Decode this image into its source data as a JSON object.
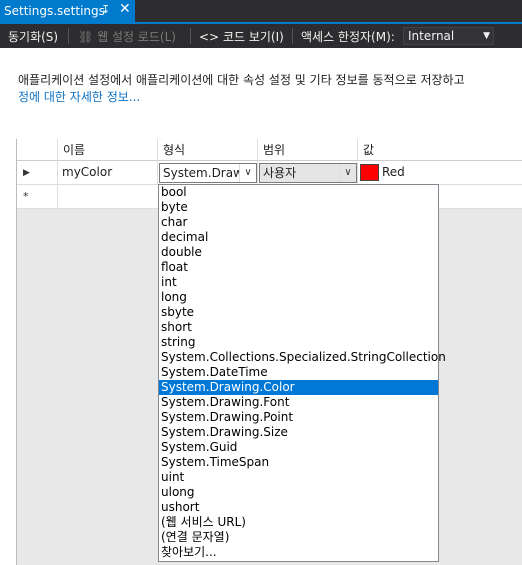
{
  "tab": {
    "title": "Settings.settings",
    "pin_glyph": "↧",
    "close_glyph": "✕"
  },
  "toolbar": {
    "sync_label": "동기화(S)",
    "web_load_label": "웹 설정 로드(L)",
    "view_code_label": "코드 보기(I)",
    "access_modifier_label": "액세스 한정자(M):",
    "access_modifier_value": "Internal"
  },
  "description": {
    "text": "애플리케이션 설정에서 애플리케이션에 대한 속성 설정 및 기타 정보를 동적으로 저장하고 ",
    "link": "정에 대한 자세한 정보..."
  },
  "grid": {
    "headers": {
      "name": "이름",
      "type": "형식",
      "scope": "범위",
      "value": "값"
    },
    "rows": [
      {
        "name": "myColor",
        "type": "System.Drawing.Color",
        "scope": "사용자",
        "value": "Red",
        "value_color": "#ff0000"
      }
    ],
    "new_row_marker": "*",
    "current_row_marker": "▶"
  },
  "dropdown": {
    "selected": "System.Drawing.Color",
    "options": [
      "bool",
      "byte",
      "char",
      "decimal",
      "double",
      "float",
      "int",
      "long",
      "sbyte",
      "short",
      "string",
      "System.Collections.Specialized.StringCollection",
      "System.DateTime",
      "System.Drawing.Color",
      "System.Drawing.Font",
      "System.Drawing.Point",
      "System.Drawing.Size",
      "System.Guid",
      "System.TimeSpan",
      "uint",
      "ulong",
      "ushort",
      "(웹 서비스 URL)",
      "(연결 문자열)",
      "찾아보기..."
    ]
  },
  "colors": {
    "accent": "#007acc",
    "selection": "#0078d7",
    "toolbar_bg": "#2d2d30"
  }
}
